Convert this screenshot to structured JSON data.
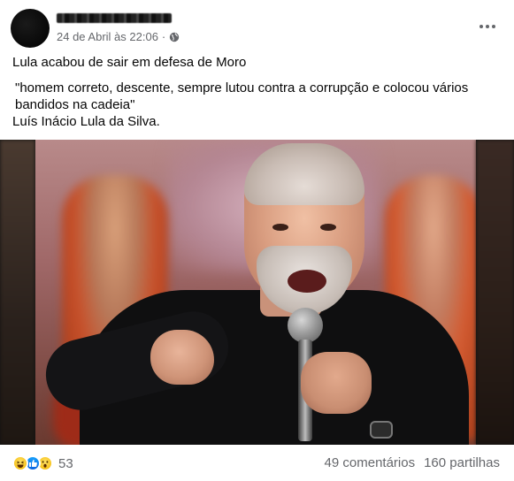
{
  "post": {
    "author_name": "",
    "timestamp": "24 de Abril às 22:06",
    "separator": "·",
    "audience_icon": "globe-icon",
    "more_icon": "more-horizontal-icon",
    "text": {
      "line1": "Lula acabou de sair em defesa de Moro",
      "quote": "\"homem correto, descente, sempre lutou contra a corrupção e colocou vários bandidos na cadeia\"",
      "attribution": "Luís Inácio Lula da Silva."
    },
    "image": {
      "icon": "photo-icon"
    },
    "footer": {
      "reactions": [
        "haha-reaction-icon",
        "like-reaction-icon",
        "wow-reaction-icon"
      ],
      "reaction_count": "53",
      "comments": "49 comentários",
      "shares": "160 partilhas"
    }
  },
  "colors": {
    "secondary_text": "#65676b",
    "primary_text": "#050505",
    "like_blue": "#0a63e0",
    "reaction_yellow": "#f7c21a"
  }
}
